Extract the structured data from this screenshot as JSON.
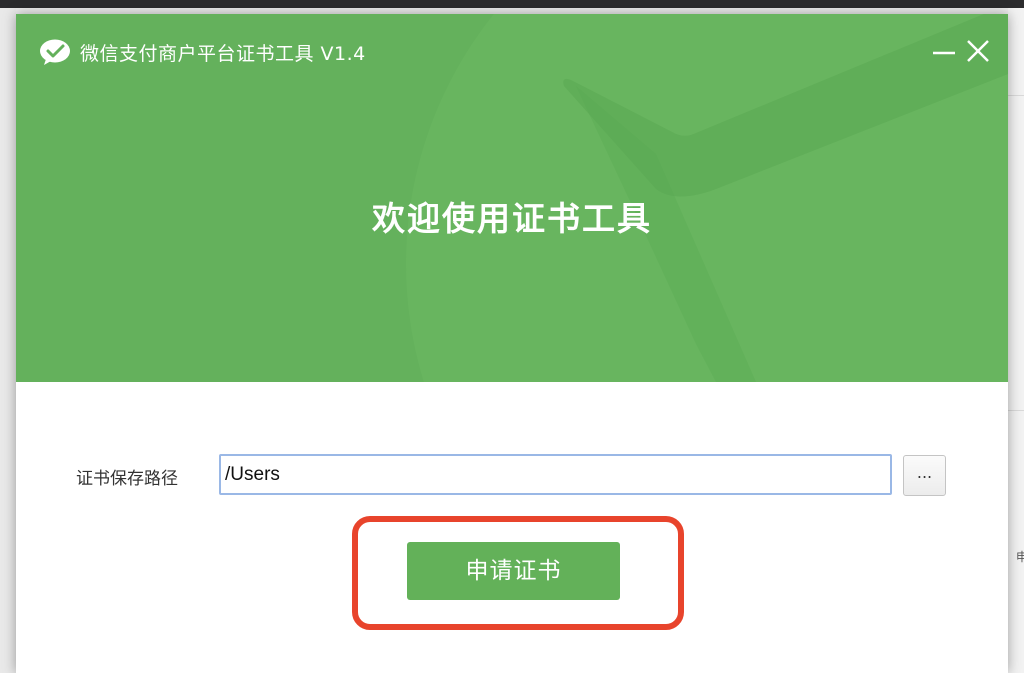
{
  "window": {
    "title": "微信支付商户平台证书工具 V1.4",
    "logo_icon": "wechat-logo-icon",
    "minimize_icon": "minimize-icon",
    "close_icon": "close-icon"
  },
  "header": {
    "welcome_text": "欢迎使用证书工具",
    "background_color": "#64b15c"
  },
  "form": {
    "path_label": "证书保存路径",
    "path_value": "/Users",
    "browse_label": "...",
    "apply_label": "申请证书"
  },
  "background_window": {
    "glyph": "申"
  },
  "colors": {
    "accent_green": "#63b159",
    "highlight_red": "#e8442c",
    "input_border": "#9ab8e6"
  }
}
